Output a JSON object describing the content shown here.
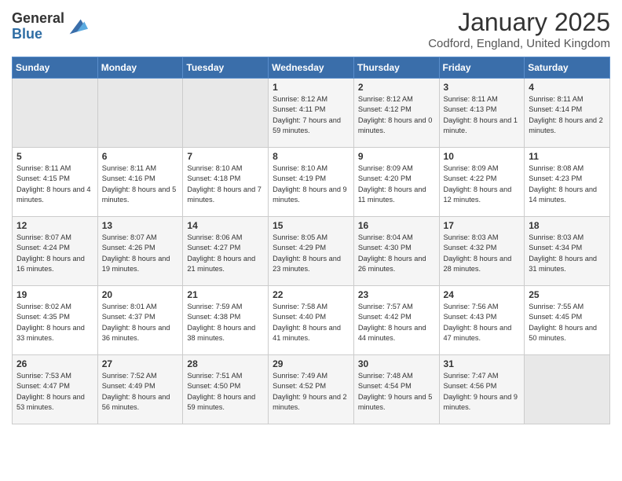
{
  "header": {
    "logo_general": "General",
    "logo_blue": "Blue",
    "month_title": "January 2025",
    "location": "Codford, England, United Kingdom"
  },
  "weekdays": [
    "Sunday",
    "Monday",
    "Tuesday",
    "Wednesday",
    "Thursday",
    "Friday",
    "Saturday"
  ],
  "weeks": [
    [
      {
        "day": "",
        "info": ""
      },
      {
        "day": "",
        "info": ""
      },
      {
        "day": "",
        "info": ""
      },
      {
        "day": "1",
        "info": "Sunrise: 8:12 AM\nSunset: 4:11 PM\nDaylight: 7 hours and 59 minutes."
      },
      {
        "day": "2",
        "info": "Sunrise: 8:12 AM\nSunset: 4:12 PM\nDaylight: 8 hours and 0 minutes."
      },
      {
        "day": "3",
        "info": "Sunrise: 8:11 AM\nSunset: 4:13 PM\nDaylight: 8 hours and 1 minute."
      },
      {
        "day": "4",
        "info": "Sunrise: 8:11 AM\nSunset: 4:14 PM\nDaylight: 8 hours and 2 minutes."
      }
    ],
    [
      {
        "day": "5",
        "info": "Sunrise: 8:11 AM\nSunset: 4:15 PM\nDaylight: 8 hours and 4 minutes."
      },
      {
        "day": "6",
        "info": "Sunrise: 8:11 AM\nSunset: 4:16 PM\nDaylight: 8 hours and 5 minutes."
      },
      {
        "day": "7",
        "info": "Sunrise: 8:10 AM\nSunset: 4:18 PM\nDaylight: 8 hours and 7 minutes."
      },
      {
        "day": "8",
        "info": "Sunrise: 8:10 AM\nSunset: 4:19 PM\nDaylight: 8 hours and 9 minutes."
      },
      {
        "day": "9",
        "info": "Sunrise: 8:09 AM\nSunset: 4:20 PM\nDaylight: 8 hours and 11 minutes."
      },
      {
        "day": "10",
        "info": "Sunrise: 8:09 AM\nSunset: 4:22 PM\nDaylight: 8 hours and 12 minutes."
      },
      {
        "day": "11",
        "info": "Sunrise: 8:08 AM\nSunset: 4:23 PM\nDaylight: 8 hours and 14 minutes."
      }
    ],
    [
      {
        "day": "12",
        "info": "Sunrise: 8:07 AM\nSunset: 4:24 PM\nDaylight: 8 hours and 16 minutes."
      },
      {
        "day": "13",
        "info": "Sunrise: 8:07 AM\nSunset: 4:26 PM\nDaylight: 8 hours and 19 minutes."
      },
      {
        "day": "14",
        "info": "Sunrise: 8:06 AM\nSunset: 4:27 PM\nDaylight: 8 hours and 21 minutes."
      },
      {
        "day": "15",
        "info": "Sunrise: 8:05 AM\nSunset: 4:29 PM\nDaylight: 8 hours and 23 minutes."
      },
      {
        "day": "16",
        "info": "Sunrise: 8:04 AM\nSunset: 4:30 PM\nDaylight: 8 hours and 26 minutes."
      },
      {
        "day": "17",
        "info": "Sunrise: 8:03 AM\nSunset: 4:32 PM\nDaylight: 8 hours and 28 minutes."
      },
      {
        "day": "18",
        "info": "Sunrise: 8:03 AM\nSunset: 4:34 PM\nDaylight: 8 hours and 31 minutes."
      }
    ],
    [
      {
        "day": "19",
        "info": "Sunrise: 8:02 AM\nSunset: 4:35 PM\nDaylight: 8 hours and 33 minutes."
      },
      {
        "day": "20",
        "info": "Sunrise: 8:01 AM\nSunset: 4:37 PM\nDaylight: 8 hours and 36 minutes."
      },
      {
        "day": "21",
        "info": "Sunrise: 7:59 AM\nSunset: 4:38 PM\nDaylight: 8 hours and 38 minutes."
      },
      {
        "day": "22",
        "info": "Sunrise: 7:58 AM\nSunset: 4:40 PM\nDaylight: 8 hours and 41 minutes."
      },
      {
        "day": "23",
        "info": "Sunrise: 7:57 AM\nSunset: 4:42 PM\nDaylight: 8 hours and 44 minutes."
      },
      {
        "day": "24",
        "info": "Sunrise: 7:56 AM\nSunset: 4:43 PM\nDaylight: 8 hours and 47 minutes."
      },
      {
        "day": "25",
        "info": "Sunrise: 7:55 AM\nSunset: 4:45 PM\nDaylight: 8 hours and 50 minutes."
      }
    ],
    [
      {
        "day": "26",
        "info": "Sunrise: 7:53 AM\nSunset: 4:47 PM\nDaylight: 8 hours and 53 minutes."
      },
      {
        "day": "27",
        "info": "Sunrise: 7:52 AM\nSunset: 4:49 PM\nDaylight: 8 hours and 56 minutes."
      },
      {
        "day": "28",
        "info": "Sunrise: 7:51 AM\nSunset: 4:50 PM\nDaylight: 8 hours and 59 minutes."
      },
      {
        "day": "29",
        "info": "Sunrise: 7:49 AM\nSunset: 4:52 PM\nDaylight: 9 hours and 2 minutes."
      },
      {
        "day": "30",
        "info": "Sunrise: 7:48 AM\nSunset: 4:54 PM\nDaylight: 9 hours and 5 minutes."
      },
      {
        "day": "31",
        "info": "Sunrise: 7:47 AM\nSunset: 4:56 PM\nDaylight: 9 hours and 9 minutes."
      },
      {
        "day": "",
        "info": ""
      }
    ]
  ]
}
